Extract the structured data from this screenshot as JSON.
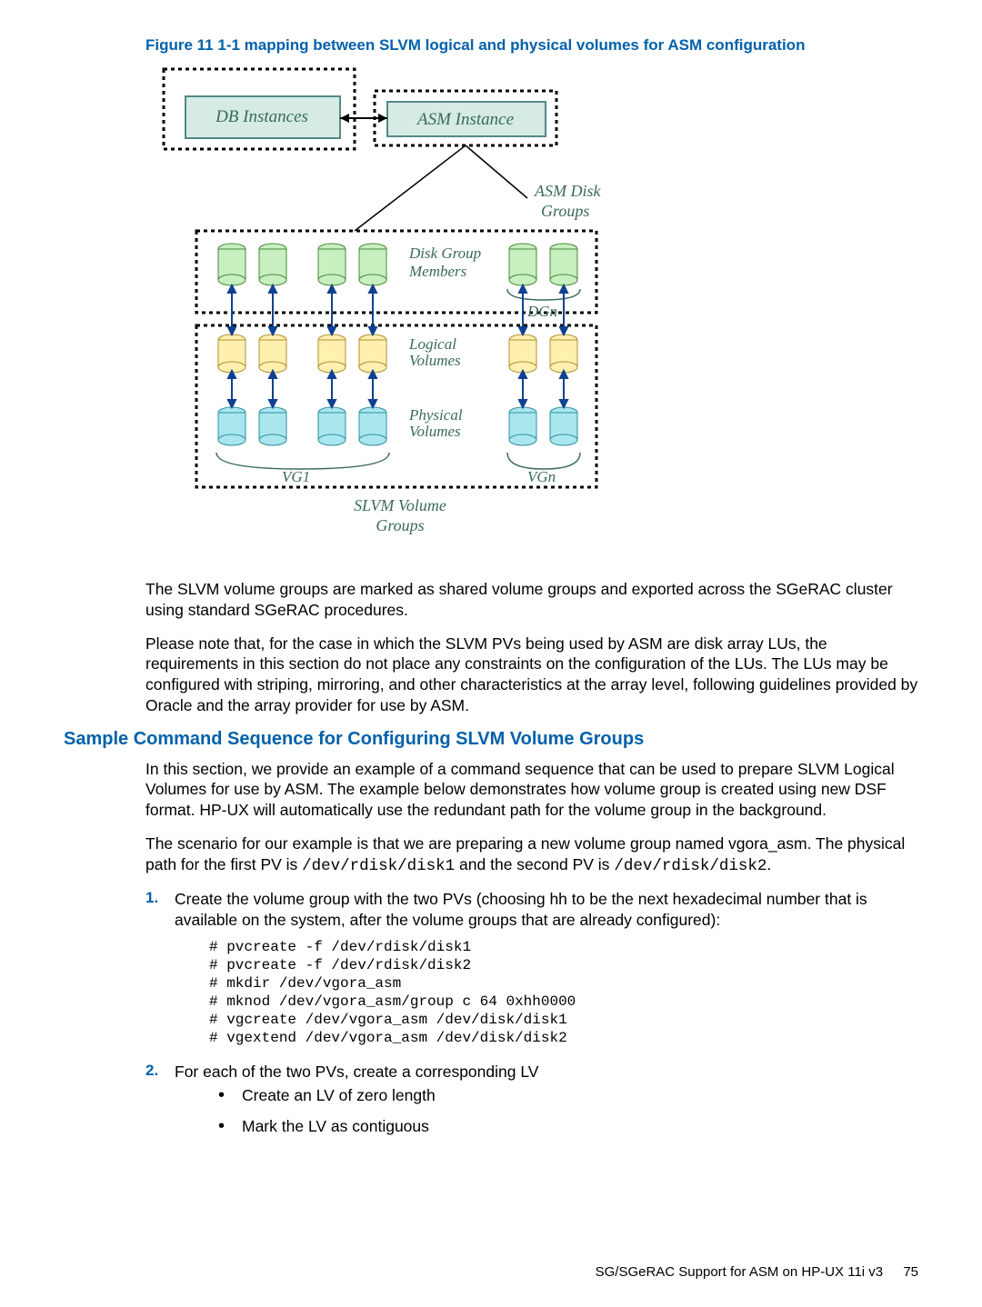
{
  "figure": {
    "caption": "Figure 11 1-1 mapping between SLVM logical and physical volumes for ASM configuration",
    "labels": {
      "db": "DB Instances",
      "asm": "ASM Instance",
      "asmdg": "ASM Disk",
      "asmdg2": "Groups",
      "dgm": "Disk Group",
      "dgm2": "Members",
      "dgn": "DGn",
      "lv": "Logical",
      "lv2": "Volumes",
      "pv": "Physical",
      "pv2": "Volumes",
      "vg1": "VG1",
      "vgn": "VGn",
      "slvm": "SLVM Volume",
      "slvm2": "Groups"
    }
  },
  "para1": "The SLVM volume groups are marked as shared volume groups and exported across the SGeRAC cluster using standard SGeRAC procedures.",
  "para2": "Please note that, for the case in which the SLVM PVs being used by ASM are disk array LUs, the requirements in this section do not place any constraints on the configuration of the LUs. The LUs may be configured with striping, mirroring, and other characteristics at the array level, following guidelines provided by Oracle and the array provider for use by ASM.",
  "section_heading": "Sample Command Sequence for Configuring SLVM Volume Groups",
  "para3": "In this section, we provide an example of a command sequence that can be used to prepare SLVM Logical Volumes for use by ASM. The example below demonstrates how volume group is created using new DSF format. HP-UX will automatically use the redundant path for the volume group in the background.",
  "para4_a": "The scenario for our example is that we are preparing a new volume group named vgora_asm. The physical path for the first PV is ",
  "para4_b": "/dev/rdisk/disk1",
  "para4_c": " and the second PV is ",
  "para4_d": "/dev/rdisk/disk2",
  "para4_e": ".",
  "step1_num": "1.",
  "step1_text": "Create the volume group with the two PVs (choosing hh to be the next hexadecimal number that is available on the system, after the volume groups that are already configured):",
  "step1_code": "# pvcreate -f /dev/rdisk/disk1\n# pvcreate -f /dev/rdisk/disk2\n# mkdir /dev/vgora_asm\n# mknod /dev/vgora_asm/group c 64 0xhh0000\n# vgcreate /dev/vgora_asm /dev/disk/disk1\n# vgextend /dev/vgora_asm /dev/disk/disk2",
  "step2_num": "2.",
  "step2_text": "For each of the two PVs, create a corresponding LV",
  "step2_b1": "Create an LV of zero length",
  "step2_b2": "Mark the LV as contiguous",
  "footer_text": "SG/SGeRAC Support for ASM on HP-UX 11i v3",
  "footer_page": "75"
}
